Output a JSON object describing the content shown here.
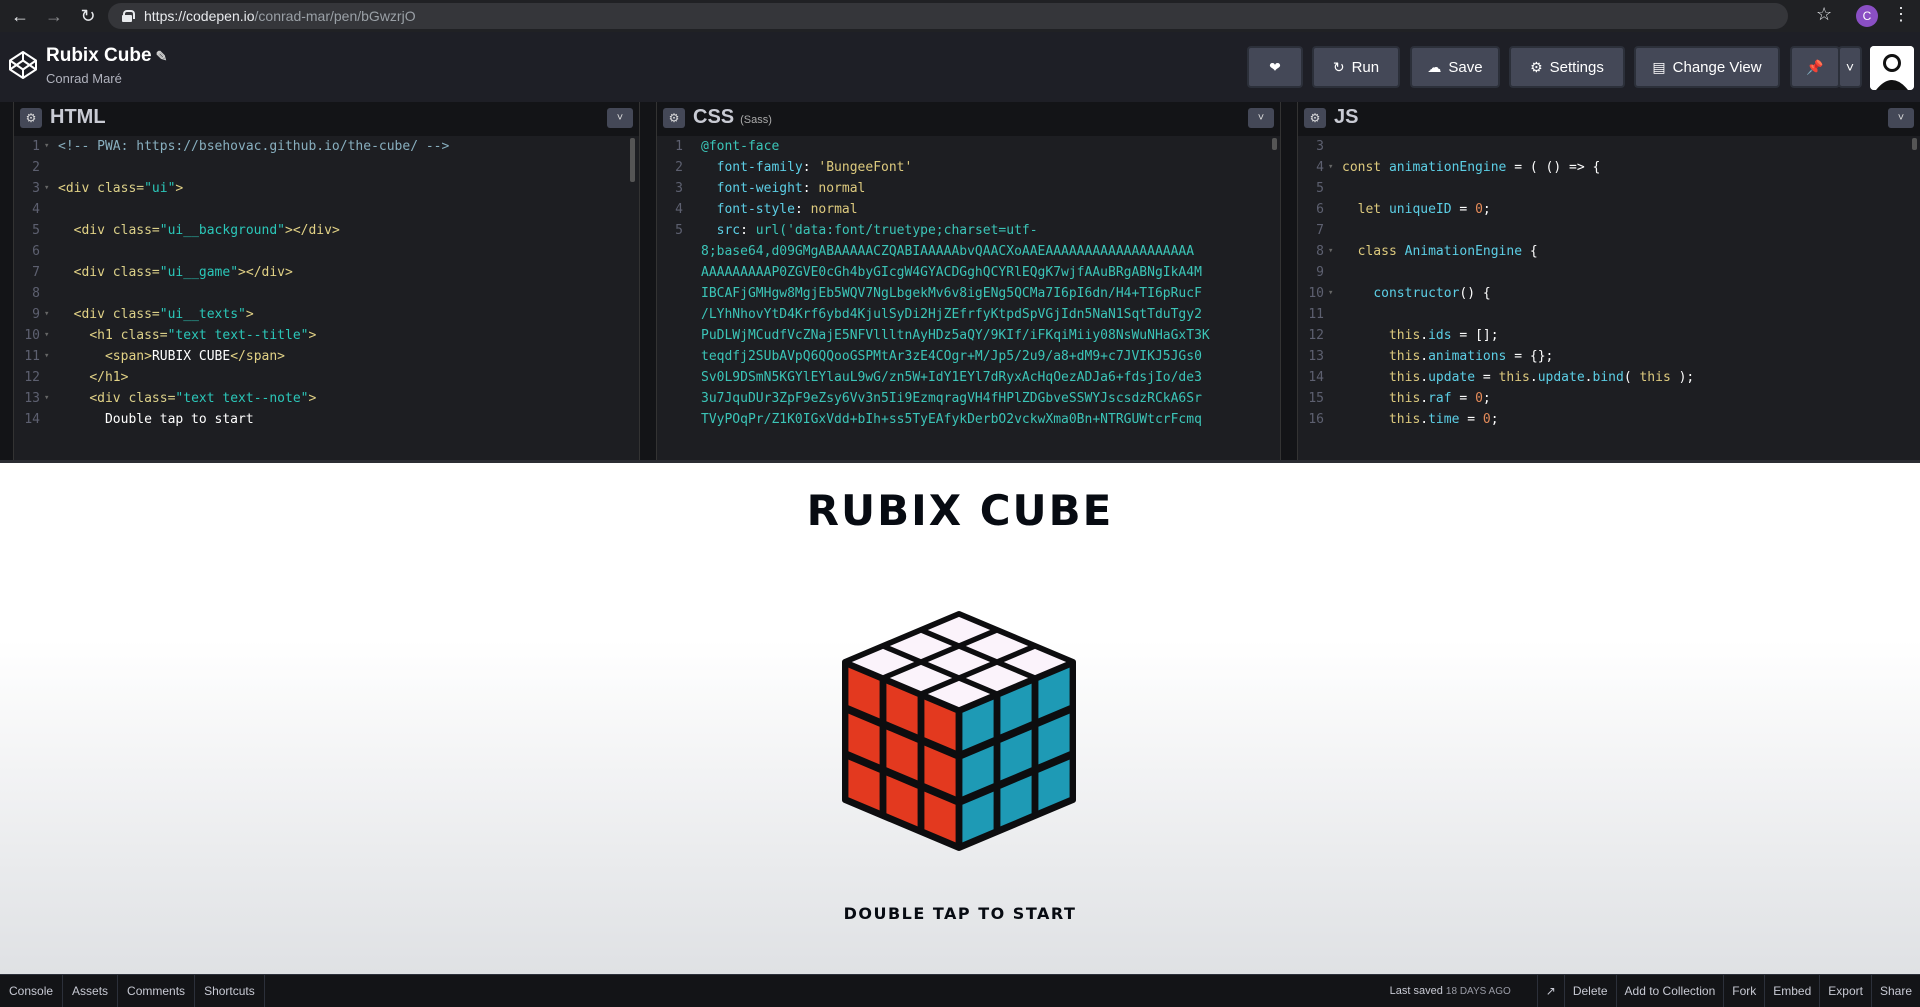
{
  "browser": {
    "url_host": "https://codepen.io",
    "url_path": "/conrad-mar/pen/bGwzrjO",
    "profile_initial": "C"
  },
  "header": {
    "pen_title": "Rubix Cube",
    "author": "Conrad Maré",
    "run_label": "Run",
    "save_label": "Save",
    "settings_label": "Settings",
    "change_view_label": "Change View"
  },
  "editors": {
    "html": {
      "title": "HTML",
      "lines": [
        {
          "n": "1",
          "fold": true,
          "parts": [
            {
              "c": "com",
              "t": "<!-- PWA: https://bsehovac.github.io/the-cube/ -->"
            }
          ]
        },
        {
          "n": "2",
          "fold": false,
          "parts": []
        },
        {
          "n": "3",
          "fold": true,
          "parts": [
            {
              "c": "tag",
              "t": "<div "
            },
            {
              "c": "attr",
              "t": "class="
            },
            {
              "c": "str",
              "t": "\"ui\""
            },
            {
              "c": "tag",
              "t": ">"
            }
          ]
        },
        {
          "n": "4",
          "fold": false,
          "parts": []
        },
        {
          "n": "5",
          "fold": false,
          "parts": [
            {
              "c": "txt",
              "t": "  "
            },
            {
              "c": "tag",
              "t": "<div "
            },
            {
              "c": "attr",
              "t": "class="
            },
            {
              "c": "str",
              "t": "\"ui__background\""
            },
            {
              "c": "tag",
              "t": "></div>"
            }
          ]
        },
        {
          "n": "6",
          "fold": false,
          "parts": []
        },
        {
          "n": "7",
          "fold": false,
          "parts": [
            {
              "c": "txt",
              "t": "  "
            },
            {
              "c": "tag",
              "t": "<div "
            },
            {
              "c": "attr",
              "t": "class="
            },
            {
              "c": "str",
              "t": "\"ui__game\""
            },
            {
              "c": "tag",
              "t": "></div>"
            }
          ]
        },
        {
          "n": "8",
          "fold": false,
          "parts": []
        },
        {
          "n": "9",
          "fold": true,
          "parts": [
            {
              "c": "txt",
              "t": "  "
            },
            {
              "c": "tag",
              "t": "<div "
            },
            {
              "c": "attr",
              "t": "class="
            },
            {
              "c": "str",
              "t": "\"ui__texts\""
            },
            {
              "c": "tag",
              "t": ">"
            }
          ]
        },
        {
          "n": "10",
          "fold": true,
          "parts": [
            {
              "c": "txt",
              "t": "    "
            },
            {
              "c": "tag",
              "t": "<h1 "
            },
            {
              "c": "attr",
              "t": "class="
            },
            {
              "c": "str",
              "t": "\"text text--title\""
            },
            {
              "c": "tag",
              "t": ">"
            }
          ]
        },
        {
          "n": "11",
          "fold": true,
          "parts": [
            {
              "c": "txt",
              "t": "      "
            },
            {
              "c": "tag",
              "t": "<span>"
            },
            {
              "c": "txt",
              "t": "RUBIX CUBE"
            },
            {
              "c": "tag",
              "t": "</span>"
            }
          ]
        },
        {
          "n": "12",
          "fold": false,
          "parts": [
            {
              "c": "txt",
              "t": "    "
            },
            {
              "c": "tag",
              "t": "</h1>"
            }
          ]
        },
        {
          "n": "13",
          "fold": true,
          "parts": [
            {
              "c": "txt",
              "t": "    "
            },
            {
              "c": "tag",
              "t": "<div "
            },
            {
              "c": "attr",
              "t": "class="
            },
            {
              "c": "str",
              "t": "\"text text--note\""
            },
            {
              "c": "tag",
              "t": ">"
            }
          ]
        },
        {
          "n": "14",
          "fold": false,
          "parts": [
            {
              "c": "txt",
              "t": "      Double tap to start"
            }
          ]
        }
      ]
    },
    "css": {
      "title": "CSS",
      "subtitle": "(Sass)",
      "lines": [
        {
          "n": "1",
          "parts": [
            {
              "c": "css-str",
              "t": "@font-face"
            }
          ]
        },
        {
          "n": "2",
          "parts": [
            {
              "c": "txt",
              "t": "  "
            },
            {
              "c": "prop",
              "t": "font-family"
            },
            {
              "c": "txt",
              "t": ": "
            },
            {
              "c": "kw",
              "t": "'BungeeFont'"
            }
          ]
        },
        {
          "n": "3",
          "parts": [
            {
              "c": "txt",
              "t": "  "
            },
            {
              "c": "prop",
              "t": "font-weight"
            },
            {
              "c": "txt",
              "t": ": "
            },
            {
              "c": "kw",
              "t": "normal"
            }
          ]
        },
        {
          "n": "4",
          "parts": [
            {
              "c": "txt",
              "t": "  "
            },
            {
              "c": "prop",
              "t": "font-style"
            },
            {
              "c": "txt",
              "t": ": "
            },
            {
              "c": "kw",
              "t": "normal"
            }
          ]
        },
        {
          "n": "5",
          "parts": [
            {
              "c": "txt",
              "t": "  "
            },
            {
              "c": "prop",
              "t": "src"
            },
            {
              "c": "txt",
              "t": ": "
            },
            {
              "c": "css-str",
              "t": "url('data:font/truetype;charset=utf-"
            }
          ]
        },
        {
          "n": "",
          "parts": [
            {
              "c": "css-str",
              "t": "8;base64,d09GMgABAAAAACZQABIAAAAAbvQAACXoAAEAAAAAAAAAAAAAAAAAAA"
            }
          ]
        },
        {
          "n": "",
          "parts": [
            {
              "c": "css-str",
              "t": "AAAAAAAAAP0ZGVE0cGh4byGIcgW4GYACDGghQCYRlEQgK7wjfAAuBRgABNgIkA4M"
            }
          ]
        },
        {
          "n": "",
          "parts": [
            {
              "c": "css-str",
              "t": "IBCAFjGMHgw8MgjEb5WQV7NgLbgekMv6v8igENg5QCMa7I6pI6dn/H4+TI6pRucF"
            }
          ]
        },
        {
          "n": "",
          "parts": [
            {
              "c": "css-str",
              "t": "/LYhNhovYtD4Krf6ybd4KjulSyDi2HjZEfrfyKtpdSpVGjIdn5NaN1SqtTduTgy2"
            }
          ]
        },
        {
          "n": "",
          "parts": [
            {
              "c": "css-str",
              "t": "PuDLWjMCudfVcZNajE5NFVllltnAyHDz5aQY/9KIf/iFKqiMiiy08NsWuNHaGxT3K"
            }
          ]
        },
        {
          "n": "",
          "parts": [
            {
              "c": "css-str",
              "t": "teqdfj2SUbAVpQ6QQooGSPMtAr3zE4COgr+M/Jp5/2u9/a8+dM9+c7JVIKJ5JGs0"
            }
          ]
        },
        {
          "n": "",
          "parts": [
            {
              "c": "css-str",
              "t": "Sv0L9DSmN5KGYlEYlauL9wG/zn5W+IdY1EYl7dRyxAcHqOezADJa6+fdsjIo/de3"
            }
          ]
        },
        {
          "n": "",
          "parts": [
            {
              "c": "css-str",
              "t": "3u7JquDUr3ZpF9eZsy6Vv3n5Ii9EzmqragVH4fHPlZDGbveSSWYJscsdzRCkA6Sr"
            }
          ]
        },
        {
          "n": "",
          "parts": [
            {
              "c": "css-str",
              "t": "TVyPOqPr/Z1K0IGxVdd+bIh+ss5TyEAfykDerbO2vckwXma0Bn+NTRGUWtcrFcmq"
            }
          ]
        }
      ]
    },
    "js": {
      "title": "JS",
      "lines": [
        {
          "n": "3",
          "fold": false,
          "parts": []
        },
        {
          "n": "4",
          "fold": true,
          "parts": [
            {
              "c": "kw",
              "t": "const "
            },
            {
              "c": "prop",
              "t": "animationEngine"
            },
            {
              "c": "txt",
              "t": " = ( () => {"
            }
          ]
        },
        {
          "n": "5",
          "fold": false,
          "parts": []
        },
        {
          "n": "6",
          "fold": false,
          "parts": [
            {
              "c": "txt",
              "t": "  "
            },
            {
              "c": "kw",
              "t": "let "
            },
            {
              "c": "prop",
              "t": "uniqueID"
            },
            {
              "c": "txt",
              "t": " = "
            },
            {
              "c": "num",
              "t": "0"
            },
            {
              "c": "txt",
              "t": ";"
            }
          ]
        },
        {
          "n": "7",
          "fold": false,
          "parts": []
        },
        {
          "n": "8",
          "fold": true,
          "parts": [
            {
              "c": "txt",
              "t": "  "
            },
            {
              "c": "kw",
              "t": "class "
            },
            {
              "c": "prop",
              "t": "AnimationEngine"
            },
            {
              "c": "txt",
              "t": " {"
            }
          ]
        },
        {
          "n": "9",
          "fold": false,
          "parts": []
        },
        {
          "n": "10",
          "fold": true,
          "parts": [
            {
              "c": "txt",
              "t": "    "
            },
            {
              "c": "prop",
              "t": "constructor"
            },
            {
              "c": "txt",
              "t": "() {"
            }
          ]
        },
        {
          "n": "11",
          "fold": false,
          "parts": []
        },
        {
          "n": "12",
          "fold": false,
          "parts": [
            {
              "c": "txt",
              "t": "      "
            },
            {
              "c": "kw",
              "t": "this"
            },
            {
              "c": "txt",
              "t": "."
            },
            {
              "c": "prop",
              "t": "ids"
            },
            {
              "c": "txt",
              "t": " = [];"
            }
          ]
        },
        {
          "n": "13",
          "fold": false,
          "parts": [
            {
              "c": "txt",
              "t": "      "
            },
            {
              "c": "kw",
              "t": "this"
            },
            {
              "c": "txt",
              "t": "."
            },
            {
              "c": "prop",
              "t": "animations"
            },
            {
              "c": "txt",
              "t": " = {};"
            }
          ]
        },
        {
          "n": "14",
          "fold": false,
          "parts": [
            {
              "c": "txt",
              "t": "      "
            },
            {
              "c": "kw",
              "t": "this"
            },
            {
              "c": "txt",
              "t": "."
            },
            {
              "c": "prop",
              "t": "update"
            },
            {
              "c": "txt",
              "t": " = "
            },
            {
              "c": "kw",
              "t": "this"
            },
            {
              "c": "txt",
              "t": "."
            },
            {
              "c": "prop",
              "t": "update"
            },
            {
              "c": "txt",
              "t": "."
            },
            {
              "c": "prop",
              "t": "bind"
            },
            {
              "c": "txt",
              "t": "( "
            },
            {
              "c": "kw",
              "t": "this"
            },
            {
              "c": "txt",
              "t": " );"
            }
          ]
        },
        {
          "n": "15",
          "fold": false,
          "parts": [
            {
              "c": "txt",
              "t": "      "
            },
            {
              "c": "kw",
              "t": "this"
            },
            {
              "c": "txt",
              "t": "."
            },
            {
              "c": "prop",
              "t": "raf"
            },
            {
              "c": "txt",
              "t": " = "
            },
            {
              "c": "num",
              "t": "0"
            },
            {
              "c": "txt",
              "t": ";"
            }
          ]
        },
        {
          "n": "16",
          "fold": false,
          "parts": [
            {
              "c": "txt",
              "t": "      "
            },
            {
              "c": "kw",
              "t": "this"
            },
            {
              "c": "txt",
              "t": "."
            },
            {
              "c": "prop",
              "t": "time"
            },
            {
              "c": "txt",
              "t": " = "
            },
            {
              "c": "num",
              "t": "0"
            },
            {
              "c": "txt",
              "t": ";"
            }
          ]
        }
      ]
    }
  },
  "preview": {
    "title": "RUBIX CUBE",
    "note": "DOUBLE TAP TO START",
    "cube_colors": {
      "top": "#fbf3fb",
      "left": "#e3391f",
      "right": "#1e9ab5",
      "frame": "#0d0d0f"
    }
  },
  "footer": {
    "left_buttons": [
      "Console",
      "Assets",
      "Comments",
      "Shortcuts"
    ],
    "last_saved_label": "Last saved",
    "last_saved_ago": "18 DAYS AGO",
    "right_buttons": [
      "Delete",
      "Add to Collection",
      "Fork",
      "Embed",
      "Export",
      "Share"
    ]
  }
}
